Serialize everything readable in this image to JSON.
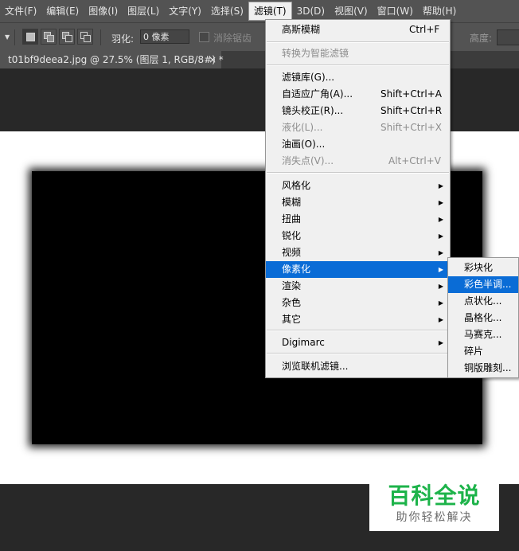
{
  "menubar": {
    "items": [
      "文件(F)",
      "编辑(E)",
      "图像(I)",
      "图层(L)",
      "文字(Y)",
      "选择(S)",
      "滤镜(T)",
      "3D(D)",
      "视图(V)",
      "窗口(W)",
      "帮助(H)"
    ]
  },
  "optionsbar": {
    "feather_label": "羽化:",
    "feather_value": "0 像素",
    "antialias_label": "消除锯齿",
    "height_label": "高度:"
  },
  "document": {
    "tab_title": "t01bf9deea2.jpg @ 27.5% (图层 1, RGB/8#) *",
    "close_glyph": "×"
  },
  "filter_menu": {
    "last_filter": {
      "label": "高斯模糊",
      "shortcut": "Ctrl+F"
    },
    "smart": {
      "label": "转换为智能滤镜"
    },
    "gallery": {
      "label": "滤镜库(G)..."
    },
    "adaptive": {
      "label": "自适应广角(A)...",
      "shortcut": "Shift+Ctrl+A"
    },
    "lens": {
      "label": "镜头校正(R)...",
      "shortcut": "Shift+Ctrl+R"
    },
    "liquify": {
      "label": "液化(L)...",
      "shortcut": "Shift+Ctrl+X"
    },
    "oil": {
      "label": "油画(O)..."
    },
    "vanish": {
      "label": "消失点(V)...",
      "shortcut": "Alt+Ctrl+V"
    },
    "stylize": {
      "label": "风格化"
    },
    "blur": {
      "label": "模糊"
    },
    "distort": {
      "label": "扭曲"
    },
    "sharpen": {
      "label": "锐化"
    },
    "video": {
      "label": "视频"
    },
    "pixelate": {
      "label": "像素化"
    },
    "render": {
      "label": "渲染"
    },
    "noise": {
      "label": "杂色"
    },
    "other": {
      "label": "其它"
    },
    "digimarc": {
      "label": "Digimarc"
    },
    "browse": {
      "label": "浏览联机滤镜..."
    }
  },
  "pixelate_submenu": {
    "items": [
      "彩块化",
      "彩色半调...",
      "点状化...",
      "晶格化...",
      "马赛克...",
      "碎片",
      "铜版雕刻..."
    ]
  },
  "watermark": {
    "title": "百科全说",
    "subtitle": "助你轻松解决"
  },
  "colors": {
    "highlight": "#0a6cd6",
    "menu_bg": "#f0f0f0",
    "app_bg": "#282828",
    "watermark_green": "#1db34a"
  }
}
